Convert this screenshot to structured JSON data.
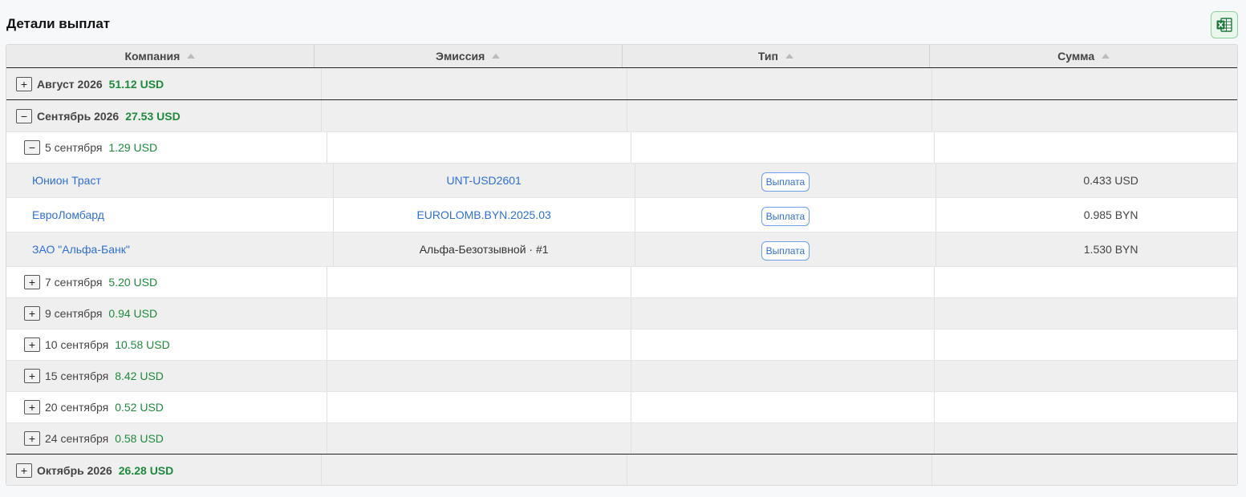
{
  "page": {
    "title": "Детали выплат",
    "export_icon": "excel-icon"
  },
  "colors": {
    "green": "#1e8a3c",
    "link": "#2f6fd6",
    "excel": "#1d7a3a"
  },
  "table": {
    "columns": [
      "Компания",
      "Эмиссия",
      "Тип",
      "Сумма"
    ],
    "months": [
      {
        "label": "Август 2026",
        "sum": "51.12 USD",
        "toggle": "+"
      },
      {
        "label": "Сентябрь 2026",
        "sum": "27.53 USD",
        "toggle": "−"
      },
      {
        "label": "Октябрь 2026",
        "sum": "26.28 USD",
        "toggle": "+"
      }
    ],
    "days": [
      {
        "label": "5 сентября",
        "sum": "1.29 USD",
        "toggle": "−"
      },
      {
        "label": "7 сентября",
        "sum": "5.20 USD",
        "toggle": "+"
      },
      {
        "label": "9 сентября",
        "sum": "0.94 USD",
        "toggle": "+"
      },
      {
        "label": "10 сентября",
        "sum": "10.58 USD",
        "toggle": "+"
      },
      {
        "label": "15 сентября",
        "sum": "8.42 USD",
        "toggle": "+"
      },
      {
        "label": "20 сентября",
        "sum": "0.52 USD",
        "toggle": "+"
      },
      {
        "label": "24 сентября",
        "sum": "0.58 USD",
        "toggle": "+"
      }
    ],
    "items": [
      {
        "company": "Юнион Траст",
        "emission": "UNT-USD2601",
        "type": "Выплата",
        "amount": "0.433 USD"
      },
      {
        "company": "ЕвроЛомбард",
        "emission": "EUROLOMB.BYN.2025.03",
        "type": "Выплата",
        "amount": "0.985 BYN"
      },
      {
        "company": "ЗАО \"Альфа-Банк\"",
        "emission": "Альфа-Безотзывной · #1",
        "type": "Выплата",
        "amount": "1.530 BYN"
      }
    ]
  }
}
